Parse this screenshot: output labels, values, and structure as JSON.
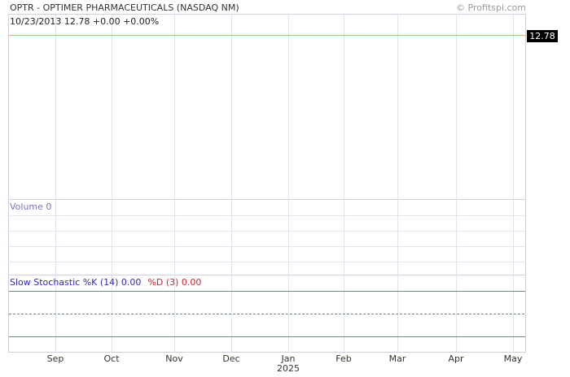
{
  "header": {
    "title": "OPTR - OPTIMER PHARMACEUTICALS (NASDAQ NM)",
    "copyright": "© Profitspi.com"
  },
  "quote": {
    "text": "10/23/2013  12.78 +0.00 +0.00%"
  },
  "colors": {
    "price_line": "#e8a070",
    "grid": "#e3e3ef",
    "border": "#cfcfdf",
    "volume_label": "#7d6fbf",
    "stoch_k": "#2b2bb5",
    "stoch_d": "#cc2233",
    "stoch_band": "#6a8a7a"
  },
  "chart_data": [
    {
      "type": "line",
      "panel": "price",
      "last_price_label": "12.78",
      "series": [
        {
          "values": [
            12.78,
            12.78
          ]
        }
      ],
      "x": [
        "Sep",
        "May"
      ],
      "grid": true
    },
    {
      "type": "bar",
      "panel": "volume",
      "label": "Volume   0",
      "values": [
        0
      ],
      "grid": true
    },
    {
      "type": "line",
      "panel": "stochastic",
      "label_k": "Slow Stochastic %K (14) 0.00",
      "label_d": "%D (3) 0.00",
      "series": [
        {
          "name": "%K",
          "values": [
            0.0
          ]
        },
        {
          "name": "%D",
          "values": [
            0.0
          ]
        }
      ],
      "levels": [
        80,
        50,
        20
      ],
      "ylim": [
        0,
        100
      ]
    }
  ],
  "x_axis": {
    "months": [
      "Sep",
      "Oct",
      "Nov",
      "Dec",
      "Jan",
      "Feb",
      "Mar",
      "Apr",
      "May"
    ],
    "year_label": "2025"
  }
}
